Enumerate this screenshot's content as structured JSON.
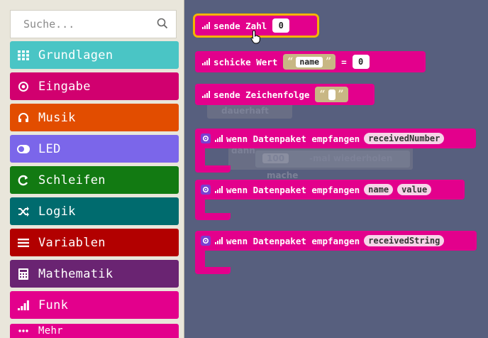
{
  "search": {
    "placeholder": "Suche..."
  },
  "categories": [
    {
      "label": "Grundlagen",
      "icon": "grid-icon",
      "color": "#4ac5c5"
    },
    {
      "label": "Eingabe",
      "icon": "target-icon",
      "color": "#d1006f"
    },
    {
      "label": "Musik",
      "icon": "headphones-icon",
      "color": "#e24d00"
    },
    {
      "label": "LED",
      "icon": "toggle-icon",
      "color": "#7b66ea"
    },
    {
      "label": "Schleifen",
      "icon": "loop-icon",
      "color": "#127a12"
    },
    {
      "label": "Logik",
      "icon": "shuffle-icon",
      "color": "#006b6e"
    },
    {
      "label": "Variablen",
      "icon": "list-icon",
      "color": "#b20000"
    },
    {
      "label": "Mathematik",
      "icon": "calculator-icon",
      "color": "#6a2472"
    },
    {
      "label": "Funk",
      "icon": "signal-icon",
      "color": "#e3008c"
    },
    {
      "label": "Mehr",
      "icon": "dots-icon",
      "color": "#e3008c"
    }
  ],
  "blocks": {
    "send_number": {
      "label": "sende Zahl",
      "value": "0"
    },
    "send_value": {
      "label": "schicke Wert",
      "name": "name",
      "equals": "=",
      "value": "0"
    },
    "send_string": {
      "label": "sende Zeichenfolge"
    },
    "on_received_number": {
      "label": "wenn Datenpaket empfangen",
      "param": "receivedNumber"
    },
    "on_received_value": {
      "label": "wenn Datenpaket empfangen",
      "param1": "name",
      "param2": "value"
    },
    "on_received_string": {
      "label": "wenn Datenpaket empfangen",
      "param": "receivedString"
    }
  },
  "background_blocks": {
    "forever": "dauerhaft",
    "then": "dann",
    "repeat_count": "100",
    "repeat_label": "-mal wiederholen",
    "do": "mache"
  },
  "colors": {
    "radio": "#e3008c",
    "workspace": "#575f7e",
    "toolbox": "#e9e6db",
    "highlight": "#f4b400"
  }
}
